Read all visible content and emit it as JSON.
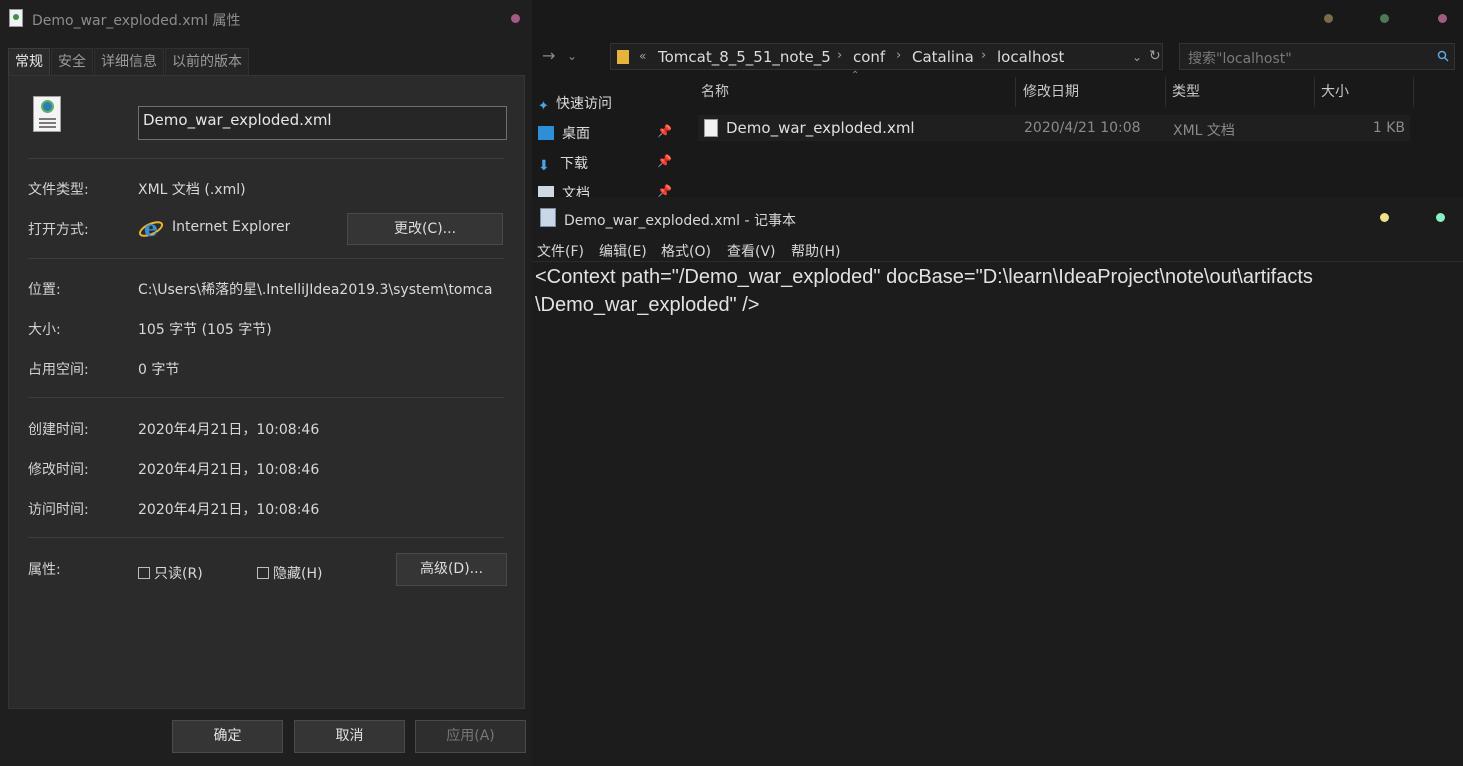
{
  "props": {
    "title": "Demo_war_exploded.xml 属性",
    "tabs": [
      "常规",
      "安全",
      "详细信息",
      "以前的版本"
    ],
    "file_name": "Demo_war_exploded.xml",
    "fields": {
      "type_label": "文件类型:",
      "type_value": "XML 文档 (.xml)",
      "open_label": "打开方式:",
      "open_value": "Internet Explorer",
      "change_button": "更改(C)...",
      "location_label": "位置:",
      "location_value": "C:\\Users\\稀落的星\\.IntelliJIdea2019.3\\system\\tomca",
      "size_label": "大小:",
      "size_value": "105 字节 (105 字节)",
      "disk_label": "占用空间:",
      "disk_value": "0 字节",
      "created_label": "创建时间:",
      "created_value": "2020年4月21日，10:08:46",
      "modified_label": "修改时间:",
      "modified_value": "2020年4月21日，10:08:46",
      "accessed_label": "访问时间:",
      "accessed_value": "2020年4月21日，10:08:46",
      "attr_label": "属性:",
      "readonly_label": "只读(R)",
      "hidden_label": "隐藏(H)",
      "advanced_button": "高级(D)..."
    },
    "buttons": {
      "ok": "确定",
      "cancel": "取消",
      "apply": "应用(A)"
    }
  },
  "explorer": {
    "breadcrumb": [
      "Tomcat_8_5_51_note_5",
      "conf",
      "Catalina",
      "localhost"
    ],
    "search_placeholder": "搜索\"localhost\"",
    "nav": [
      {
        "label": "快速访问",
        "icon": "star-icon"
      },
      {
        "label": "桌面",
        "icon": "desktop-icon"
      },
      {
        "label": "下载",
        "icon": "download-icon"
      },
      {
        "label": "文档",
        "icon": "document-icon"
      }
    ],
    "columns": [
      "名称",
      "修改日期",
      "类型",
      "大小"
    ],
    "files": [
      {
        "name": "Demo_war_exploded.xml",
        "modified": "2020/4/21 10:08",
        "type": "XML 文档",
        "size": "1 KB"
      }
    ],
    "title_dot_colors": [
      "#7a6a4a",
      "#4d7a55",
      "#a35b86"
    ]
  },
  "notepad": {
    "title": "Demo_war_exploded.xml - 记事本",
    "menu": [
      "文件(F)",
      "编辑(E)",
      "格式(O)",
      "查看(V)",
      "帮助(H)"
    ],
    "content_lines": [
      "<Context path=\"/Demo_war_exploded\" docBase=\"D:\\learn\\IdeaProject\\note\\out\\artifacts",
      "\\Demo_war_exploded\" />"
    ],
    "title_dot_colors": [
      "#f3e08a",
      "#8af0c2"
    ]
  }
}
